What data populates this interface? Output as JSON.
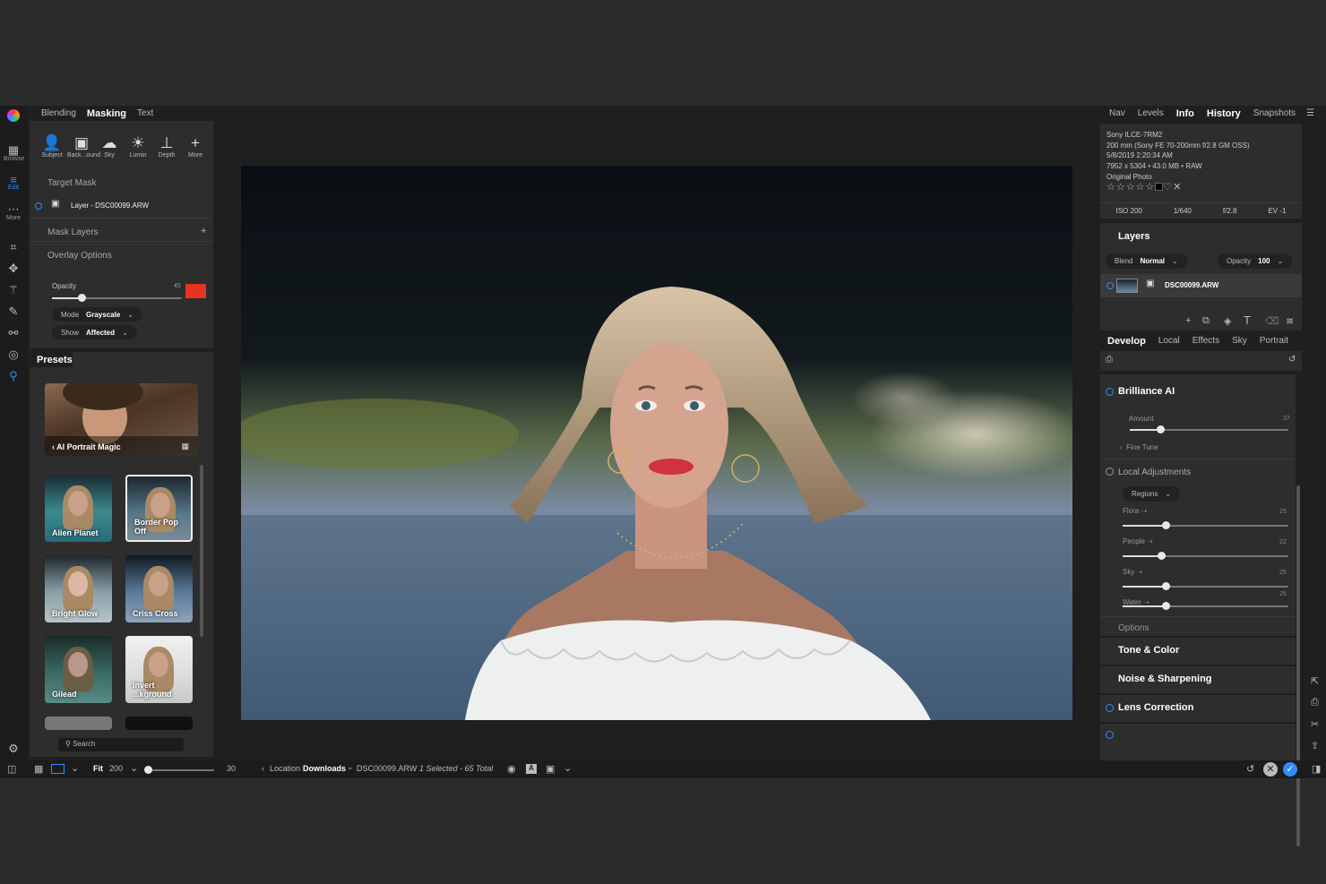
{
  "left_tabs": [
    "Blending",
    "Masking",
    "Text"
  ],
  "rail": [
    {
      "icon": "browse-icon",
      "glyph": "▦",
      "label": "Browse"
    },
    {
      "icon": "edit-icon",
      "glyph": "≡",
      "label": "Edit"
    },
    {
      "icon": "more-icon",
      "glyph": "⋯",
      "label": "More"
    }
  ],
  "mask_tools": [
    {
      "icon": "subject-icon",
      "glyph": "👤",
      "label": "Subject"
    },
    {
      "icon": "background-icon",
      "glyph": "▣",
      "label": "Back...ound"
    },
    {
      "icon": "sky-icon",
      "glyph": "☁",
      "label": "Sky"
    },
    {
      "icon": "luminosity-icon",
      "glyph": "☀",
      "label": "Lumin"
    },
    {
      "icon": "depth-icon",
      "glyph": "⊥",
      "label": "Depth"
    },
    {
      "icon": "more-plus-icon",
      "glyph": "+",
      "label": "More"
    }
  ],
  "mask": {
    "target_label": "Target Mask",
    "layer_name": "Layer - DSC00099.ARW",
    "mask_layers_label": "Mask Layers",
    "overlay_label": "Overlay Options",
    "opacity_label": "Opacity",
    "opacity_value": "45",
    "opacity_fraction": 0.23,
    "overlay_color": "#e8341f",
    "mode_label": "Mode",
    "mode_value": "Grayscale",
    "show_label": "Show",
    "show_value": "Affected"
  },
  "presets": {
    "tab": "Presets",
    "featured": "AI Portrait Magic",
    "items": [
      "Alien Planet",
      "Border Pop Off",
      "Bright Glow",
      "Criss Cross",
      "Gilead",
      "Invert ...kground"
    ],
    "search_placeholder": "Search"
  },
  "right_tabs": [
    "Nav",
    "Levels",
    "Info",
    "History",
    "Snapshots"
  ],
  "info": {
    "camera": "Sony ILCE-7RM2",
    "lens": "200 mm (Sony FE 70-200mm f/2.8 GM OSS)",
    "date": "5/8/2019 2:20:34 AM",
    "size": "7952 x 5304 • 43.0 MB • RAW",
    "type": "Original Photo",
    "stats": [
      "ISO 200",
      "1/640",
      "f/2.8",
      "EV -1"
    ]
  },
  "layers": {
    "title": "Layers",
    "blend_label": "Blend",
    "blend_value": "Normal",
    "opacity_label": "Opacity",
    "opacity_value": "100",
    "layer_name": "DSC00099.ARW"
  },
  "develop_tabs": [
    "Develop",
    "Local",
    "Effects",
    "Sky",
    "Portrait"
  ],
  "brilliance": {
    "title": "Brilliance AI",
    "amount_label": "Amount",
    "amount_value": "37",
    "amount_fraction": 0.19,
    "fine_tune": "Fine Tune",
    "local_label": "Local Adjustments",
    "regions_label": "Regions",
    "regions": [
      {
        "label": "Flora",
        "value": "25",
        "fraction": 0.26
      },
      {
        "label": "People",
        "value": "22",
        "fraction": 0.23
      },
      {
        "label": "Sky",
        "value": "25",
        "fraction": 0.26
      },
      {
        "label": "Water",
        "value": "25",
        "fraction": 0.26
      }
    ],
    "options": "Options"
  },
  "sections": [
    "Tone & Color",
    "Noise & Sharpening",
    "Lens Correction"
  ],
  "bottom": {
    "fit_label": "Fit",
    "zoom": "200",
    "thumb_size": "30",
    "location_label": "Location",
    "location_value": "Downloads",
    "file": "DSC00099.ARW",
    "selection": "1 Selected - 65 Total"
  },
  "accent": "#2f8cff"
}
